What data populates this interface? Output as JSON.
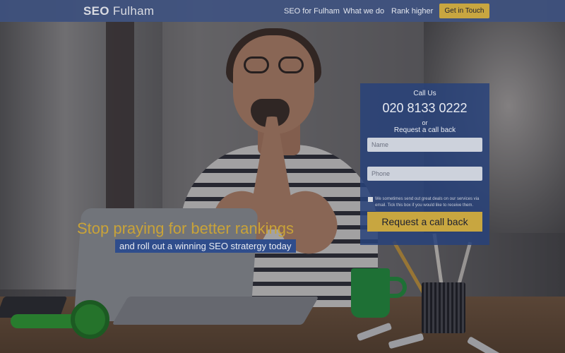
{
  "header": {
    "logo_bold": "SEO",
    "logo_rest": "Fulham",
    "nav": [
      "SEO for Fulham",
      "What we do",
      "Rank higher"
    ],
    "cta_label": "Get in Touch"
  },
  "hero": {
    "headline": "Stop praying for better rankings",
    "subline": "and roll out a winning SEO stratergy today"
  },
  "form": {
    "call_us": "Call Us",
    "phone": "020 8133 0222",
    "or": "or",
    "request_label": "Request a call back",
    "name_placeholder": "Name",
    "phone_placeholder": "Phone",
    "consent_text": "We sometimes send out great deals on our services via email. Tick this box if you would like to receive them.",
    "submit_label": "Request a call back"
  },
  "colors": {
    "header_bg": "#3f5280",
    "accent_gold": "#c8a640",
    "panel_bg": "#28427a"
  }
}
